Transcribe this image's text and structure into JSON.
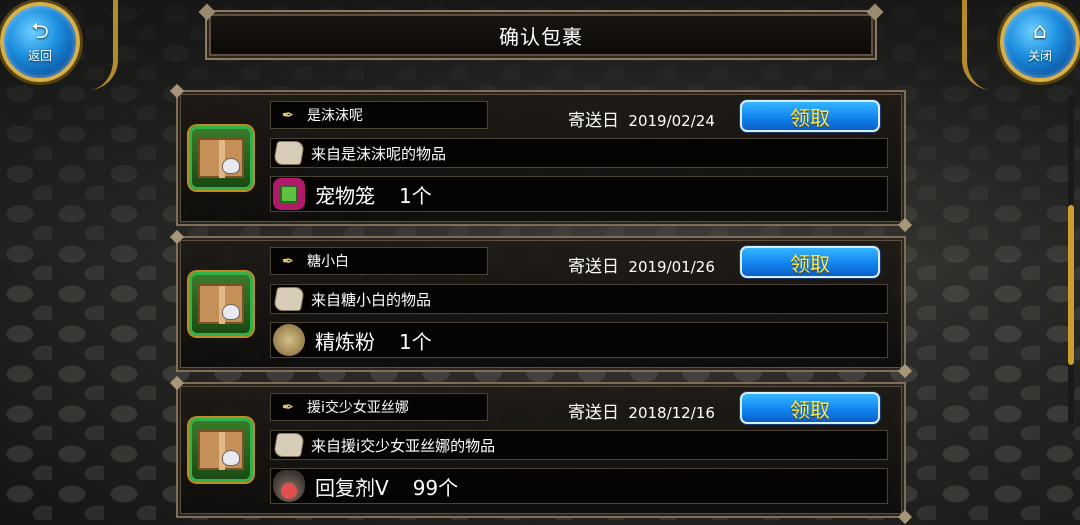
{
  "header": {
    "title": "确认包裹",
    "back_label": "返回",
    "close_label": "关闭"
  },
  "parcels": [
    {
      "sender": "是沫沫呢",
      "date_label": "寄送日",
      "date": "2019/02/24",
      "claim_label": "领取",
      "description": "来自是沫沫呢的物品",
      "item_name": "宠物笼",
      "item_qty": "1个",
      "item_icon": "cage-icon"
    },
    {
      "sender": "糖小白",
      "date_label": "寄送日",
      "date": "2019/01/26",
      "claim_label": "领取",
      "description": "来自糖小白的物品",
      "item_name": "精炼粉",
      "item_qty": "1个",
      "item_icon": "powder-pouch-icon"
    },
    {
      "sender": "援i交少女亚丝娜",
      "date_label": "寄送日",
      "date": "2018/12/16",
      "claim_label": "领取",
      "description": "来自援i交少女亚丝娜的物品",
      "item_name": "回复剂Ⅴ",
      "item_qty": "99个",
      "item_icon": "potion-flask-icon"
    }
  ],
  "colors": {
    "claim_button": "#1284f0",
    "claim_text": "#ffe94a",
    "frame": "#7d6e58",
    "parcel_border": "#2fb34a"
  }
}
